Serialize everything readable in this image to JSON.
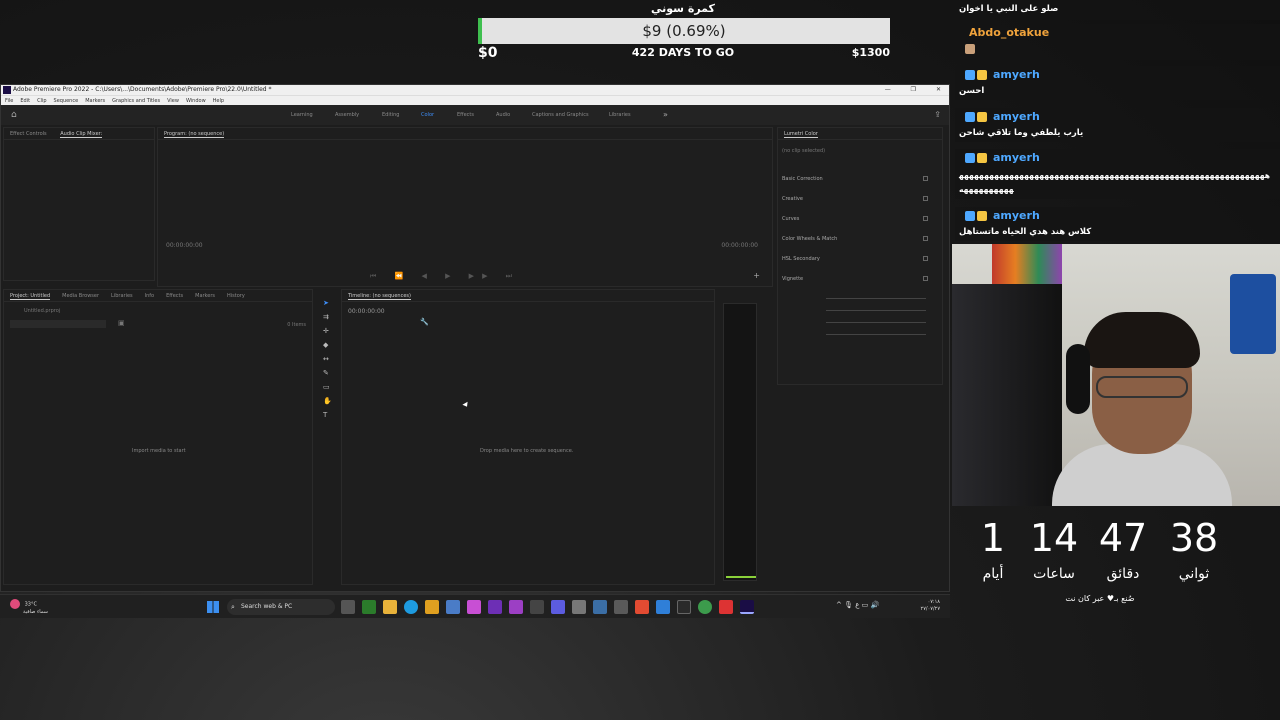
{
  "goal": {
    "title": "كمرة سوني",
    "amount": "$9 (0.69%)",
    "progress_percent": 0.69,
    "min": "$0",
    "days_left": "422 DAYS TO GO",
    "max": "$1300",
    "fill_color": "#3fbf4f"
  },
  "premiere": {
    "title": "Adobe Premiere Pro 2022 - C:\\Users\\...\\Documents\\Adobe\\Premiere Pro\\22.0\\Untitled *",
    "menu": [
      "File",
      "Edit",
      "Clip",
      "Sequence",
      "Markers",
      "Graphics and Titles",
      "View",
      "Window",
      "Help"
    ],
    "workspaces": [
      "Learning",
      "Assembly",
      "Editing",
      "Color",
      "Effects",
      "Audio",
      "Captions and Graphics",
      "Libraries"
    ],
    "active_workspace": "Color",
    "source_tabs": [
      "Effect Controls",
      "Audio Clip Mixer:"
    ],
    "program_tab": "Program: (no sequence)",
    "program_tc_left": "00:00:00:00",
    "program_tc_right": "00:00:00:00",
    "lumetri": {
      "tab": "Lumetri Color",
      "no_clip": "(no clip selected)",
      "sections": [
        "Basic Correction",
        "Creative",
        "Curves",
        "Color Wheels & Match",
        "HSL Secondary",
        "Vignette"
      ]
    },
    "project_tabs": [
      "Project: Untitled",
      "Media Browser",
      "Libraries",
      "Info",
      "Effects",
      "Markers",
      "History"
    ],
    "project_file": "Untitled.prproj",
    "item_count": "0 Items",
    "import_hint": "Import media to start",
    "timeline_tab": "Timeline: (no sequences)",
    "timeline_tc": "00:00:00:00",
    "timeline_hint": "Drop media here to create sequence."
  },
  "taskbar": {
    "weather_temp": "33°C",
    "weather_desc": "سماء صافية",
    "search_label": "Search web & PC",
    "time": "٠٧:١٨",
    "date": "٢٧/٠٧/٢٧"
  },
  "chat": {
    "lines": [
      {
        "user": "",
        "text": "صلو على النبي يا اخوان"
      },
      {
        "user": "Abdo_otakue",
        "text": ""
      },
      {
        "user": "amyerh",
        "text": "احسن"
      },
      {
        "user": "amyerh",
        "text": "يارب يلطفي وما تلاقي شاحن"
      },
      {
        "user": "amyerh",
        "text": "ههههههههههههههههههههههههههههههههههههههههههههههههههههههههههههههههههههههههه"
      },
      {
        "user": "amyerh",
        "text": "كلاس هند هدي الحياه ماتستاهل"
      }
    ],
    "user_colors": {
      "Abdo_otakue": "#f0a33c",
      "amyerh": "#4ea8ff"
    }
  },
  "countdown": {
    "units": [
      {
        "value": "1",
        "label": "أيام"
      },
      {
        "value": "14",
        "label": "ساعات"
      },
      {
        "value": "47",
        "label": "دقائق"
      },
      {
        "value": "38",
        "label": "ثواني"
      }
    ],
    "footer": "صُنع بـ♥ عبر كان نت"
  }
}
